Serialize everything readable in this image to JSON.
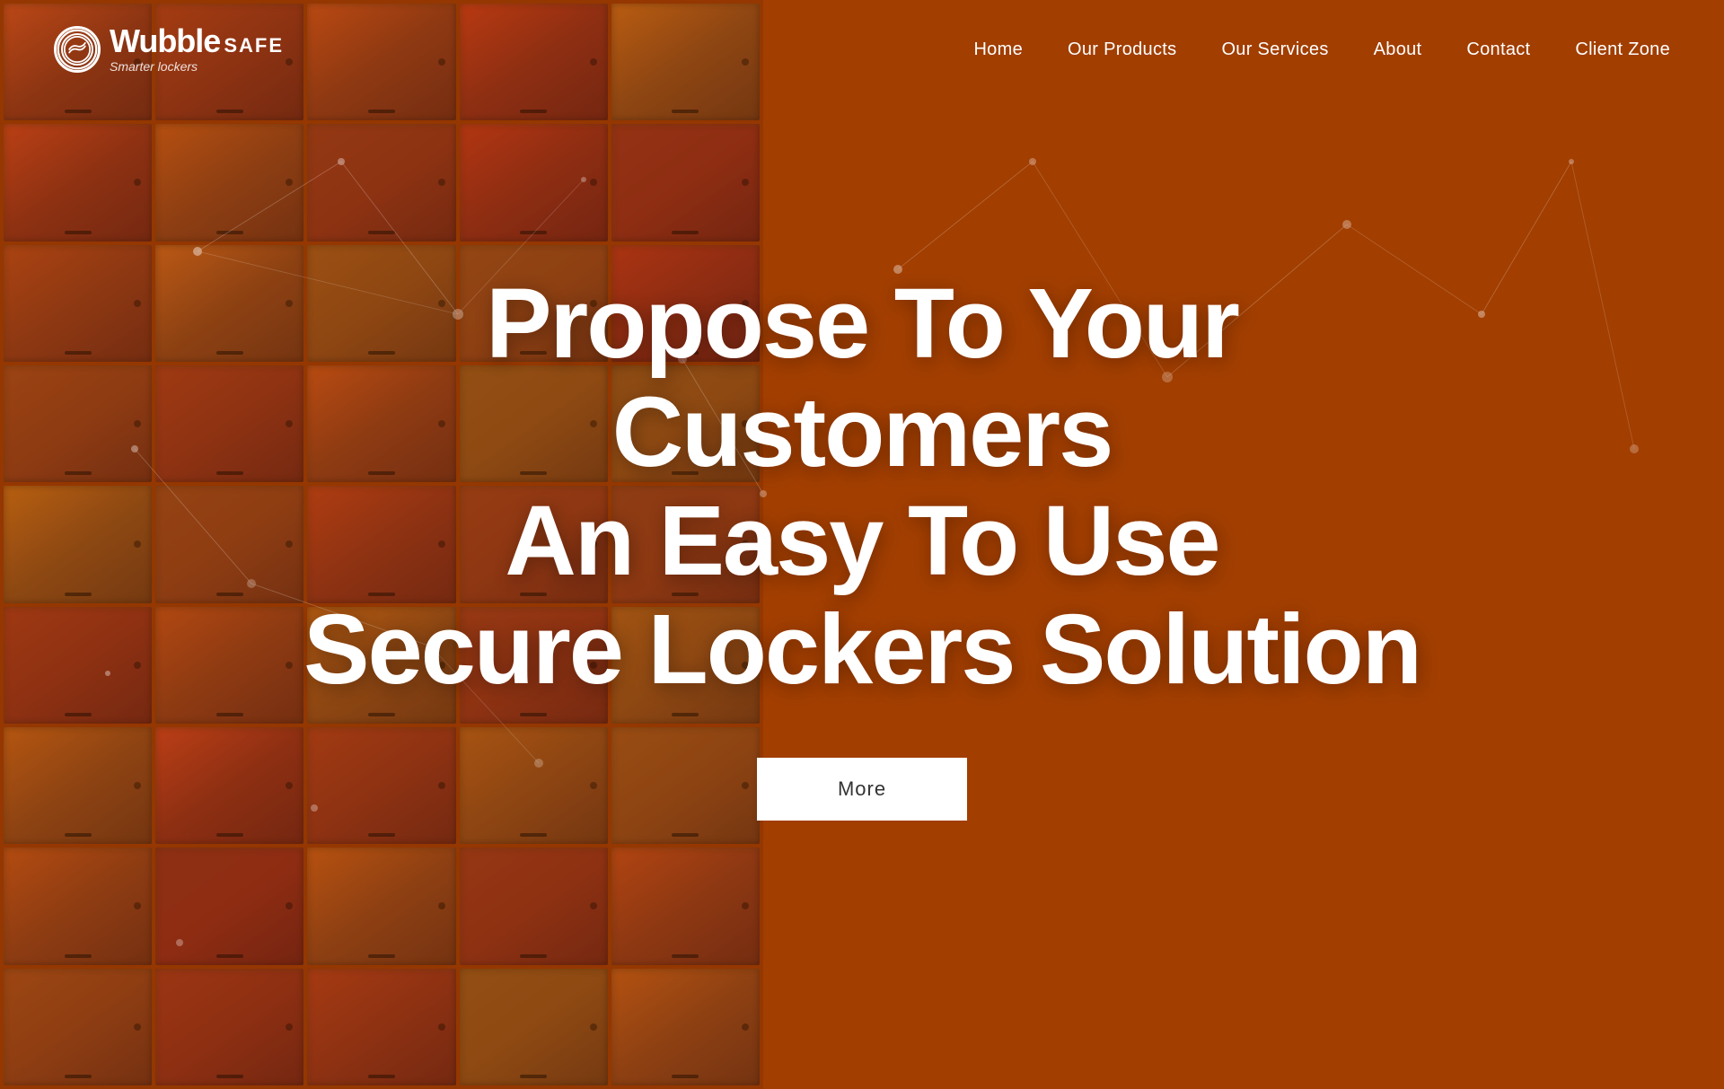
{
  "brand": {
    "name": "Wubble",
    "safe": "SAFE",
    "tagline": "Smarter lockers"
  },
  "nav": {
    "links": [
      {
        "id": "home",
        "label": "Home"
      },
      {
        "id": "products",
        "label": "Our Products"
      },
      {
        "id": "services",
        "label": "Our Services"
      },
      {
        "id": "about",
        "label": "About"
      },
      {
        "id": "contact",
        "label": "Contact"
      },
      {
        "id": "client-zone",
        "label": "Client Zone"
      }
    ]
  },
  "hero": {
    "title_line1": "Propose To Your Customers",
    "title_line2": "An Easy To Use",
    "title_line3": "Secure Lockers Solution",
    "cta_label": "More"
  },
  "colors": {
    "brand_orange": "#d05000",
    "dark_overlay": "rgba(80,30,0,0.35)",
    "white": "#ffffff",
    "nav_bg": "transparent"
  }
}
